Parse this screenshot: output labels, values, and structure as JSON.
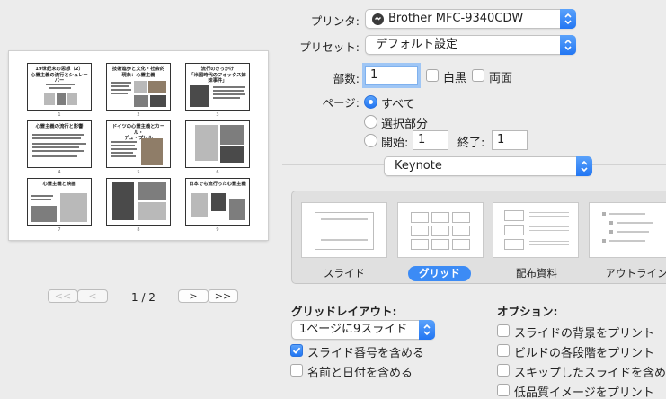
{
  "preview": {
    "thumbnails": [
      {
        "title": "19世紀末の思想（2）\n心霊主義の流行とシュレーバー",
        "num": "1"
      },
      {
        "title": "技術進歩と文化・社会的\n現象：心霊主義",
        "num": "2"
      },
      {
        "title": "流行のきっかけ\n「米国時代のフォックス姉妹事件」",
        "num": "3"
      },
      {
        "title": "心霊主義の流行と影響",
        "num": "4"
      },
      {
        "title": "ドイツの心霊主義とカール・\nデュ・プレル",
        "num": "5"
      },
      {
        "title": "",
        "num": "6"
      },
      {
        "title": "心霊主義と映画",
        "num": "7"
      },
      {
        "title": "",
        "num": "8"
      },
      {
        "title": "日本でも流行った心霊主義",
        "num": "9"
      }
    ],
    "pager": {
      "first": "<<",
      "prev": "<",
      "indicator": "1 / 2",
      "next": ">",
      "last": ">>"
    }
  },
  "printer": {
    "label": "プリンタ:",
    "value": "Brother MFC-9340CDW"
  },
  "preset": {
    "label": "プリセット:",
    "value": "デフォルト設定"
  },
  "copies": {
    "label": "部数:",
    "value": "1",
    "bw_label": "白黒",
    "two_sided_label": "両面"
  },
  "pages": {
    "label": "ページ:",
    "all": "すべて",
    "selection": "選択部分",
    "from_label": "開始:",
    "from_value": "1",
    "to_label": "終了:",
    "to_value": "1"
  },
  "app_menu": {
    "value": "Keynote"
  },
  "layouts": {
    "slide": "スライド",
    "grid": "グリッド",
    "handout": "配布資料",
    "outline": "アウトライン"
  },
  "grid_layout": {
    "title": "グリッドレイアウト:",
    "select_value": "1ページに9スライド",
    "include_numbers": "スライド番号を含める",
    "include_name_date": "名前と日付を含める"
  },
  "options": {
    "title": "オプション:",
    "print_backgrounds": "スライドの背景をプリント",
    "print_build_stages": "ビルドの各段階をプリント",
    "include_skipped": "スキップしたスライドを含める",
    "low_quality": "低品質イメージをプリント"
  },
  "colors": {
    "accent": "#3c8bf5",
    "background": "#ececec"
  }
}
